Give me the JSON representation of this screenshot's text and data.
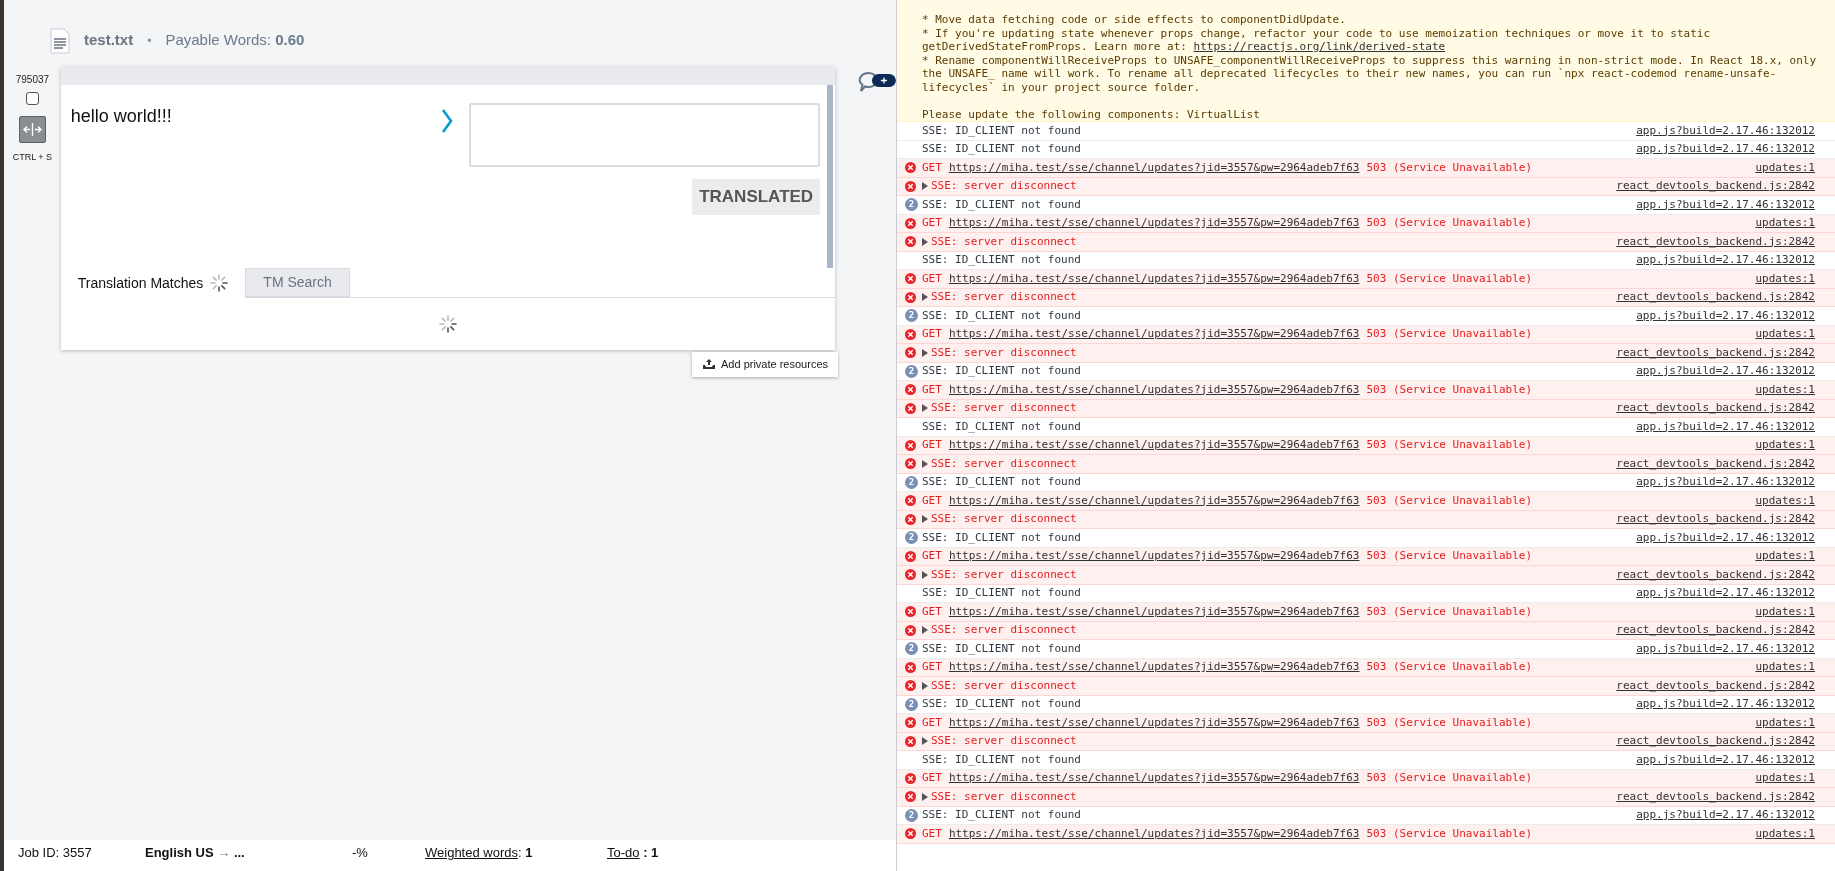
{
  "header": {
    "file_name": "test.txt",
    "separator": "•",
    "payable": "Payable Words: **0.60**"
  },
  "segment": {
    "id": "795037",
    "checked": false,
    "shortcut": "CTRL + S",
    "source": "hello world!!!",
    "status_button": "TRANSLATED"
  },
  "tabs": [
    {
      "label": "Translation Matches",
      "selected": true,
      "loading": true
    },
    {
      "label": "TM Search",
      "selected": false,
      "loading": false
    }
  ],
  "add_resources_button": "Add private resources",
  "status_bar": {
    "job_id": "Job ID: 3557",
    "source_language": "English US",
    "arrow": "→",
    "target_language": "...",
    "progress": "-%",
    "weighted_label": "Weighted words",
    "weighted_rest": ": **1**",
    "todo_label": "To-do",
    "todo_rest": " **: 1**"
  },
  "console": {
    "warning_lines": [
      {
        "text": "* Move data fetching code or side effects to componentDidUpdate."
      },
      {
        "text": "* If you're updating state whenever props change, refactor your code to use memoization techniques or move it to static"
      },
      {
        "text": "getDerivedStateFromProps. Learn more at: ",
        "link": "https://reactjs.org/link/derived-state"
      },
      {
        "text": "* Rename componentWillReceiveProps to UNSAFE_componentWillReceiveProps to suppress this warning in non-strict mode. In React 18.x, only"
      },
      {
        "text": "the UNSAFE_ name will work. To rename all deprecated lifecycles to their new names, you can run `npx react-codemod rename-unsafe-"
      },
      {
        "text": "lifecycles` in your project source folder."
      },
      {
        "text": "Please update the following components: VirtualList",
        "spaced": true
      }
    ],
    "rows": [
      {
        "kind": "info",
        "text": "SSE: ID_CLIENT not found",
        "source": "app.js?build=2.17.46:132012"
      },
      {
        "kind": "info",
        "text": "SSE: ID_CLIENT not found",
        "source": "app.js?build=2.17.46:132012"
      },
      {
        "kind": "get",
        "method": "GET",
        "url": "https://miha.test/sse/channel/updates?jid=3557&pw=2964adeb7f63",
        "status": "503 (Service Unavailable)",
        "source": "updates:1"
      },
      {
        "kind": "disconnect",
        "text": "SSE: server disconnect",
        "source": "react_devtools_backend.js:2842"
      },
      {
        "kind": "info",
        "count": "2",
        "text": "SSE: ID_CLIENT not found",
        "source": "app.js?build=2.17.46:132012"
      },
      {
        "kind": "get",
        "method": "GET",
        "url": "https://miha.test/sse/channel/updates?jid=3557&pw=2964adeb7f63",
        "status": "503 (Service Unavailable)",
        "source": "updates:1"
      },
      {
        "kind": "disconnect",
        "text": "SSE: server disconnect",
        "source": "react_devtools_backend.js:2842"
      },
      {
        "kind": "info",
        "text": "SSE: ID_CLIENT not found",
        "source": "app.js?build=2.17.46:132012"
      },
      {
        "kind": "get",
        "method": "GET",
        "url": "https://miha.test/sse/channel/updates?jid=3557&pw=2964adeb7f63",
        "status": "503 (Service Unavailable)",
        "source": "updates:1"
      },
      {
        "kind": "disconnect",
        "text": "SSE: server disconnect",
        "source": "react_devtools_backend.js:2842"
      },
      {
        "kind": "info",
        "count": "2",
        "text": "SSE: ID_CLIENT not found",
        "source": "app.js?build=2.17.46:132012"
      },
      {
        "kind": "get",
        "method": "GET",
        "url": "https://miha.test/sse/channel/updates?jid=3557&pw=2964adeb7f63",
        "status": "503 (Service Unavailable)",
        "source": "updates:1"
      },
      {
        "kind": "disconnect",
        "text": "SSE: server disconnect",
        "source": "react_devtools_backend.js:2842"
      },
      {
        "kind": "info",
        "count": "2",
        "text": "SSE: ID_CLIENT not found",
        "source": "app.js?build=2.17.46:132012"
      },
      {
        "kind": "get",
        "method": "GET",
        "url": "https://miha.test/sse/channel/updates?jid=3557&pw=2964adeb7f63",
        "status": "503 (Service Unavailable)",
        "source": "updates:1"
      },
      {
        "kind": "disconnect",
        "text": "SSE: server disconnect",
        "source": "react_devtools_backend.js:2842"
      },
      {
        "kind": "info",
        "text": "SSE: ID_CLIENT not found",
        "source": "app.js?build=2.17.46:132012"
      },
      {
        "kind": "get",
        "method": "GET",
        "url": "https://miha.test/sse/channel/updates?jid=3557&pw=2964adeb7f63",
        "status": "503 (Service Unavailable)",
        "source": "updates:1"
      },
      {
        "kind": "disconnect",
        "text": "SSE: server disconnect",
        "source": "react_devtools_backend.js:2842"
      },
      {
        "kind": "info",
        "count": "2",
        "text": "SSE: ID_CLIENT not found",
        "source": "app.js?build=2.17.46:132012"
      },
      {
        "kind": "get",
        "method": "GET",
        "url": "https://miha.test/sse/channel/updates?jid=3557&pw=2964adeb7f63",
        "status": "503 (Service Unavailable)",
        "source": "updates:1"
      },
      {
        "kind": "disconnect",
        "text": "SSE: server disconnect",
        "source": "react_devtools_backend.js:2842"
      },
      {
        "kind": "info",
        "count": "2",
        "text": "SSE: ID_CLIENT not found",
        "source": "app.js?build=2.17.46:132012"
      },
      {
        "kind": "get",
        "method": "GET",
        "url": "https://miha.test/sse/channel/updates?jid=3557&pw=2964adeb7f63",
        "status": "503 (Service Unavailable)",
        "source": "updates:1"
      },
      {
        "kind": "disconnect",
        "text": "SSE: server disconnect",
        "source": "react_devtools_backend.js:2842"
      },
      {
        "kind": "info",
        "text": "SSE: ID_CLIENT not found",
        "source": "app.js?build=2.17.46:132012"
      },
      {
        "kind": "get",
        "method": "GET",
        "url": "https://miha.test/sse/channel/updates?jid=3557&pw=2964adeb7f63",
        "status": "503 (Service Unavailable)",
        "source": "updates:1"
      },
      {
        "kind": "disconnect",
        "text": "SSE: server disconnect",
        "source": "react_devtools_backend.js:2842"
      },
      {
        "kind": "info",
        "count": "2",
        "text": "SSE: ID_CLIENT not found",
        "source": "app.js?build=2.17.46:132012"
      },
      {
        "kind": "get",
        "method": "GET",
        "url": "https://miha.test/sse/channel/updates?jid=3557&pw=2964adeb7f63",
        "status": "503 (Service Unavailable)",
        "source": "updates:1"
      },
      {
        "kind": "disconnect",
        "text": "SSE: server disconnect",
        "source": "react_devtools_backend.js:2842"
      },
      {
        "kind": "info",
        "count": "2",
        "text": "SSE: ID_CLIENT not found",
        "source": "app.js?build=2.17.46:132012"
      },
      {
        "kind": "get",
        "method": "GET",
        "url": "https://miha.test/sse/channel/updates?jid=3557&pw=2964adeb7f63",
        "status": "503 (Service Unavailable)",
        "source": "updates:1"
      },
      {
        "kind": "disconnect",
        "text": "SSE: server disconnect",
        "source": "react_devtools_backend.js:2842"
      },
      {
        "kind": "info",
        "text": "SSE: ID_CLIENT not found",
        "source": "app.js?build=2.17.46:132012"
      },
      {
        "kind": "get",
        "method": "GET",
        "url": "https://miha.test/sse/channel/updates?jid=3557&pw=2964adeb7f63",
        "status": "503 (Service Unavailable)",
        "source": "updates:1"
      },
      {
        "kind": "disconnect",
        "text": "SSE: server disconnect",
        "source": "react_devtools_backend.js:2842"
      },
      {
        "kind": "info",
        "count": "2",
        "text": "SSE: ID_CLIENT not found",
        "source": "app.js?build=2.17.46:132012"
      },
      {
        "kind": "get",
        "method": "GET",
        "url": "https://miha.test/sse/channel/updates?jid=3557&pw=2964adeb7f63",
        "status": "503 (Service Unavailable)",
        "source": "updates:1"
      }
    ]
  }
}
